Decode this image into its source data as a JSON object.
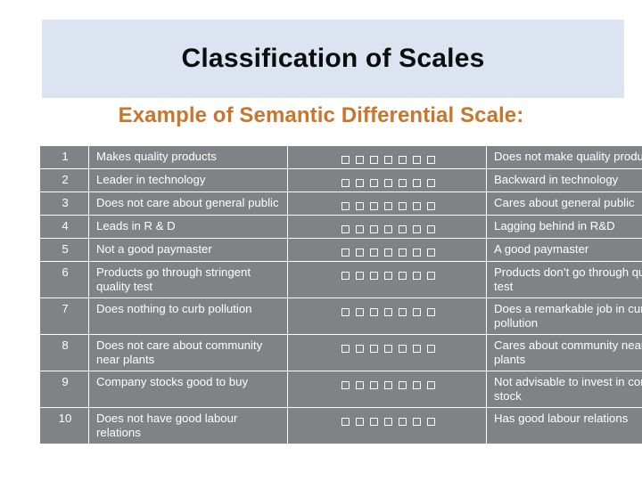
{
  "slide": {
    "title": "Classification of Scales",
    "subtitle": "Example of Semantic Differential Scale:",
    "title_band_color": "#dbe4f0",
    "subtitle_color": "#c8762c",
    "table_bg_color": "#808285",
    "table_text_color": "#ffffff"
  },
  "table": {
    "scale_points": 7,
    "rows": [
      {
        "num": "1",
        "left": "Makes quality products",
        "right": "Does not make quality products"
      },
      {
        "num": "2",
        "left": "Leader in technology",
        "right": "Backward in technology"
      },
      {
        "num": "3",
        "left": "Does not care about general public",
        "right": "Cares about general public"
      },
      {
        "num": "4",
        "left": "Leads in R & D",
        "right": "Lagging behind in R&D"
      },
      {
        "num": "5",
        "left": "Not a good paymaster",
        "right": "A good paymaster"
      },
      {
        "num": "6",
        "left": "Products go through stringent quality test",
        "right": "Products don’t go through quality test"
      },
      {
        "num": "7",
        "left": "Does nothing to curb pollution",
        "right": "Does a remarkable job in curbing pollution"
      },
      {
        "num": "8",
        "left": "Does not care about community near plants",
        "right": "Cares about community near plants"
      },
      {
        "num": "9",
        "left": "Company stocks good to buy",
        "right": "Not advisable to invest in company stock"
      },
      {
        "num": "10",
        "left": "Does not have good labour relations",
        "right": "Has good labour relations"
      }
    ]
  }
}
